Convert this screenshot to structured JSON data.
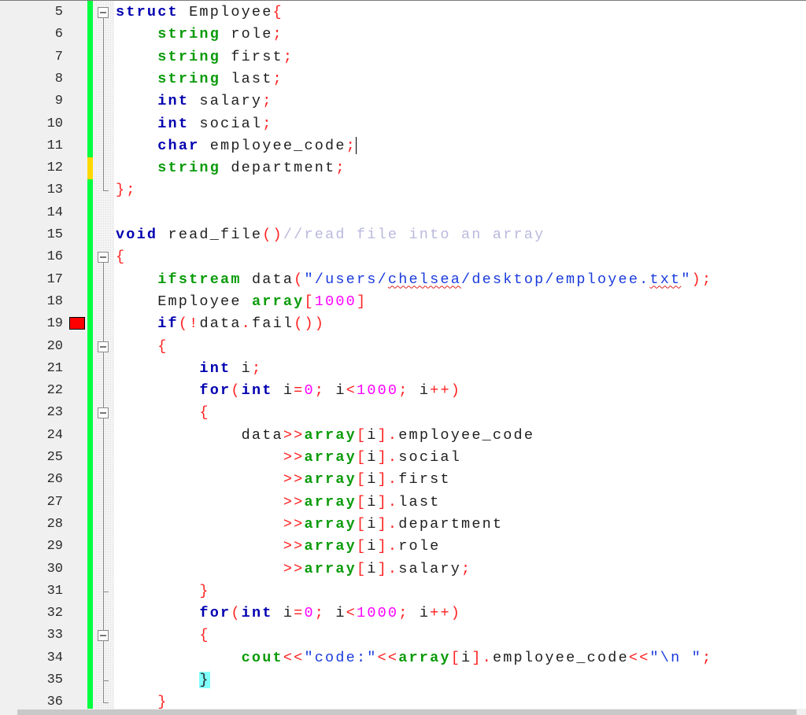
{
  "editor": {
    "language": "C++",
    "first_visible_line": 5,
    "last_visible_line": 36,
    "breakpoint_line": 19,
    "modified_line_yellow": 12,
    "caret_line": 11,
    "matched_brace_line": 35,
    "colors": {
      "keyword": "#0000b0",
      "type": "#0a9b0a",
      "operator": "#ff2020",
      "number": "#ff00ff",
      "string": "#1a3bdc",
      "comment": "#b9b9dd",
      "change_bar_saved": "#00ff40",
      "change_bar_modified": "#ffd800",
      "breakpoint": "#ff0000",
      "brace_match": "#80ffff"
    },
    "lines": [
      {
        "n": "5",
        "tokens": [
          [
            "kw",
            "struct"
          ],
          [
            "id",
            " Employee"
          ],
          [
            "op",
            "{"
          ]
        ]
      },
      {
        "n": "6",
        "tokens": [
          [
            "id",
            "    "
          ],
          [
            "ty",
            "string"
          ],
          [
            "id",
            " role"
          ],
          [
            "op",
            ";"
          ]
        ]
      },
      {
        "n": "7",
        "tokens": [
          [
            "id",
            "    "
          ],
          [
            "ty",
            "string"
          ],
          [
            "id",
            " first"
          ],
          [
            "op",
            ";"
          ]
        ]
      },
      {
        "n": "8",
        "tokens": [
          [
            "id",
            "    "
          ],
          [
            "ty",
            "string"
          ],
          [
            "id",
            " last"
          ],
          [
            "op",
            ";"
          ]
        ]
      },
      {
        "n": "9",
        "tokens": [
          [
            "id",
            "    "
          ],
          [
            "kw",
            "int"
          ],
          [
            "id",
            " salary"
          ],
          [
            "op",
            ";"
          ]
        ]
      },
      {
        "n": "10",
        "tokens": [
          [
            "id",
            "    "
          ],
          [
            "kw",
            "int"
          ],
          [
            "id",
            " social"
          ],
          [
            "op",
            ";"
          ]
        ]
      },
      {
        "n": "11",
        "tokens": [
          [
            "id",
            "    "
          ],
          [
            "kw",
            "char"
          ],
          [
            "id",
            " employee_code"
          ],
          [
            "op",
            ";"
          ],
          [
            "caret",
            ""
          ]
        ]
      },
      {
        "n": "12",
        "tokens": [
          [
            "id",
            "    "
          ],
          [
            "ty",
            "string"
          ],
          [
            "id",
            " department"
          ],
          [
            "op",
            ";"
          ]
        ]
      },
      {
        "n": "13",
        "tokens": [
          [
            "op",
            "};"
          ]
        ]
      },
      {
        "n": "14",
        "tokens": []
      },
      {
        "n": "15",
        "tokens": [
          [
            "kw",
            "void"
          ],
          [
            "id",
            " read_file"
          ],
          [
            "op",
            "()"
          ],
          [
            "com",
            "//read file into an array"
          ]
        ]
      },
      {
        "n": "16",
        "tokens": [
          [
            "op",
            "{"
          ]
        ]
      },
      {
        "n": "17",
        "tokens": [
          [
            "id",
            "    "
          ],
          [
            "ty",
            "ifstream"
          ],
          [
            "id",
            " data"
          ],
          [
            "op",
            "("
          ],
          [
            "str",
            "\"/users/"
          ],
          [
            "str squig",
            "chelsea"
          ],
          [
            "str",
            "/desktop/employee."
          ],
          [
            "str squig",
            "txt"
          ],
          [
            "str",
            "\""
          ],
          [
            "op",
            ");"
          ]
        ]
      },
      {
        "n": "18",
        "tokens": [
          [
            "id",
            "    Employee "
          ],
          [
            "ty",
            "array"
          ],
          [
            "op",
            "["
          ],
          [
            "num",
            "1000"
          ],
          [
            "op",
            "]"
          ]
        ]
      },
      {
        "n": "19",
        "tokens": [
          [
            "id",
            "    "
          ],
          [
            "kw",
            "if"
          ],
          [
            "op",
            "(!"
          ],
          [
            "id",
            "data"
          ],
          [
            "op",
            "."
          ],
          [
            "id",
            "fail"
          ],
          [
            "op",
            "())"
          ]
        ]
      },
      {
        "n": "20",
        "tokens": [
          [
            "id",
            "    "
          ],
          [
            "op",
            "{"
          ]
        ]
      },
      {
        "n": "21",
        "tokens": [
          [
            "id",
            "        "
          ],
          [
            "kw",
            "int"
          ],
          [
            "id",
            " i"
          ],
          [
            "op",
            ";"
          ]
        ]
      },
      {
        "n": "22",
        "tokens": [
          [
            "id",
            "        "
          ],
          [
            "kw",
            "for"
          ],
          [
            "op",
            "("
          ],
          [
            "kw",
            "int"
          ],
          [
            "id",
            " i"
          ],
          [
            "op",
            "="
          ],
          [
            "num",
            "0"
          ],
          [
            "op",
            ";"
          ],
          [
            "id",
            " i"
          ],
          [
            "op",
            "<"
          ],
          [
            "num",
            "1000"
          ],
          [
            "op",
            ";"
          ],
          [
            "id",
            " i"
          ],
          [
            "op",
            "++)"
          ]
        ]
      },
      {
        "n": "23",
        "tokens": [
          [
            "id",
            "        "
          ],
          [
            "op",
            "{"
          ]
        ]
      },
      {
        "n": "24",
        "tokens": [
          [
            "id",
            "            data"
          ],
          [
            "op",
            ">>"
          ],
          [
            "ty",
            "array"
          ],
          [
            "op",
            "["
          ],
          [
            "id",
            "i"
          ],
          [
            "op",
            "]"
          ],
          [
            "op",
            "."
          ],
          [
            "id",
            "employee_code"
          ]
        ]
      },
      {
        "n": "25",
        "tokens": [
          [
            "id",
            "                "
          ],
          [
            "op",
            ">>"
          ],
          [
            "ty",
            "array"
          ],
          [
            "op",
            "["
          ],
          [
            "id",
            "i"
          ],
          [
            "op",
            "]"
          ],
          [
            "op",
            "."
          ],
          [
            "id",
            "social"
          ]
        ]
      },
      {
        "n": "26",
        "tokens": [
          [
            "id",
            "                "
          ],
          [
            "op",
            ">>"
          ],
          [
            "ty",
            "array"
          ],
          [
            "op",
            "["
          ],
          [
            "id",
            "i"
          ],
          [
            "op",
            "]"
          ],
          [
            "op",
            "."
          ],
          [
            "id",
            "first"
          ]
        ]
      },
      {
        "n": "27",
        "tokens": [
          [
            "id",
            "                "
          ],
          [
            "op",
            ">>"
          ],
          [
            "ty",
            "array"
          ],
          [
            "op",
            "["
          ],
          [
            "id",
            "i"
          ],
          [
            "op",
            "]"
          ],
          [
            "op",
            "."
          ],
          [
            "id",
            "last"
          ]
        ]
      },
      {
        "n": "28",
        "tokens": [
          [
            "id",
            "                "
          ],
          [
            "op",
            ">>"
          ],
          [
            "ty",
            "array"
          ],
          [
            "op",
            "["
          ],
          [
            "id",
            "i"
          ],
          [
            "op",
            "]"
          ],
          [
            "op",
            "."
          ],
          [
            "id",
            "department"
          ]
        ]
      },
      {
        "n": "29",
        "tokens": [
          [
            "id",
            "                "
          ],
          [
            "op",
            ">>"
          ],
          [
            "ty",
            "array"
          ],
          [
            "op",
            "["
          ],
          [
            "id",
            "i"
          ],
          [
            "op",
            "]"
          ],
          [
            "op",
            "."
          ],
          [
            "id",
            "role"
          ]
        ]
      },
      {
        "n": "30",
        "tokens": [
          [
            "id",
            "                "
          ],
          [
            "op",
            ">>"
          ],
          [
            "ty",
            "array"
          ],
          [
            "op",
            "["
          ],
          [
            "id",
            "i"
          ],
          [
            "op",
            "]"
          ],
          [
            "op",
            "."
          ],
          [
            "id",
            "salary"
          ],
          [
            "op",
            ";"
          ]
        ]
      },
      {
        "n": "31",
        "tokens": [
          [
            "id",
            "        "
          ],
          [
            "op",
            "}"
          ]
        ]
      },
      {
        "n": "32",
        "tokens": [
          [
            "id",
            "        "
          ],
          [
            "kw",
            "for"
          ],
          [
            "op",
            "("
          ],
          [
            "kw",
            "int"
          ],
          [
            "id",
            " i"
          ],
          [
            "op",
            "="
          ],
          [
            "num",
            "0"
          ],
          [
            "op",
            ";"
          ],
          [
            "id",
            " i"
          ],
          [
            "op",
            "<"
          ],
          [
            "num",
            "1000"
          ],
          [
            "op",
            ";"
          ],
          [
            "id",
            " i"
          ],
          [
            "op",
            "++)"
          ]
        ]
      },
      {
        "n": "33",
        "tokens": [
          [
            "id",
            "        "
          ],
          [
            "op",
            "{"
          ]
        ]
      },
      {
        "n": "34",
        "tokens": [
          [
            "id",
            "            "
          ],
          [
            "ty",
            "cout"
          ],
          [
            "op",
            "<<"
          ],
          [
            "str",
            "\"code:\""
          ],
          [
            "op",
            "<<"
          ],
          [
            "ty",
            "array"
          ],
          [
            "op",
            "["
          ],
          [
            "id",
            "i"
          ],
          [
            "op",
            "]"
          ],
          [
            "op",
            "."
          ],
          [
            "id",
            "employee_code"
          ],
          [
            "op",
            "<<"
          ],
          [
            "str",
            "\"\\n \""
          ],
          [
            "op",
            ";"
          ]
        ]
      },
      {
        "n": "35",
        "tokens": [
          [
            "id",
            "        "
          ],
          [
            "id brace-hl",
            "}"
          ]
        ]
      },
      {
        "n": "36",
        "tokens": [
          [
            "id",
            "    "
          ],
          [
            "op",
            "}"
          ]
        ]
      }
    ],
    "fold_markers": [
      {
        "line": "5",
        "type": "box"
      },
      {
        "line": "13",
        "type": "end"
      },
      {
        "line": "16",
        "type": "box"
      },
      {
        "line": "20",
        "type": "box"
      },
      {
        "line": "23",
        "type": "box"
      },
      {
        "line": "31",
        "type": "tick"
      },
      {
        "line": "33",
        "type": "box"
      },
      {
        "line": "35",
        "type": "tick"
      },
      {
        "line": "36",
        "type": "tick"
      }
    ]
  }
}
